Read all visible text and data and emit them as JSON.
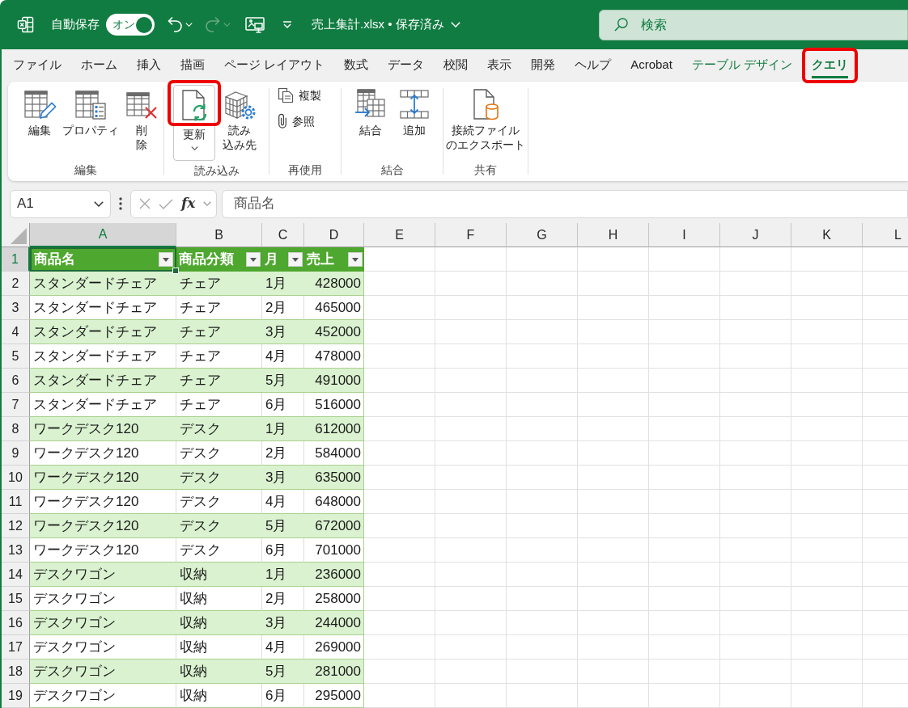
{
  "title_bar": {
    "autosave": {
      "label": "自動保存",
      "toggle_label": "オン",
      "on": true
    },
    "undo": {
      "disabled": false
    },
    "redo": {
      "disabled": true
    },
    "document_title": "売上集計.xlsx • 保存済み",
    "search": {
      "placeholder": "検索"
    }
  },
  "ribbon_tabs": [
    {
      "label": "ファイル",
      "kind": "standard",
      "selected": false,
      "highlighted": false
    },
    {
      "label": "ホーム",
      "kind": "standard",
      "selected": false,
      "highlighted": false
    },
    {
      "label": "挿入",
      "kind": "standard",
      "selected": false,
      "highlighted": false
    },
    {
      "label": "描画",
      "kind": "standard",
      "selected": false,
      "highlighted": false
    },
    {
      "label": "ページ レイアウト",
      "kind": "standard",
      "selected": false,
      "highlighted": false
    },
    {
      "label": "数式",
      "kind": "standard",
      "selected": false,
      "highlighted": false
    },
    {
      "label": "データ",
      "kind": "standard",
      "selected": false,
      "highlighted": false
    },
    {
      "label": "校閲",
      "kind": "standard",
      "selected": false,
      "highlighted": false
    },
    {
      "label": "表示",
      "kind": "standard",
      "selected": false,
      "highlighted": false
    },
    {
      "label": "開発",
      "kind": "standard",
      "selected": false,
      "highlighted": false
    },
    {
      "label": "ヘルプ",
      "kind": "standard",
      "selected": false,
      "highlighted": false
    },
    {
      "label": "Acrobat",
      "kind": "standard",
      "selected": false,
      "highlighted": false
    },
    {
      "label": "テーブル デザイン",
      "kind": "contextual",
      "selected": false,
      "highlighted": false
    },
    {
      "label": "クエリ",
      "kind": "contextual",
      "selected": true,
      "highlighted": true
    }
  ],
  "ribbon_groups": [
    {
      "label": "編集",
      "commands": [
        {
          "label": "編集",
          "kind": "large",
          "highlighted": false
        },
        {
          "label": "プロパティ",
          "kind": "large",
          "highlighted": false
        },
        {
          "label": "削除",
          "kind": "large",
          "highlighted": false
        }
      ]
    },
    {
      "label": "読み込み",
      "commands": [
        {
          "label": "更新",
          "kind": "split",
          "highlighted": true
        },
        {
          "label": "読み込み先",
          "kind": "large",
          "highlighted": false
        }
      ]
    },
    {
      "label": "再使用",
      "commands": [
        {
          "label": "複製",
          "kind": "small",
          "highlighted": false
        },
        {
          "label": "参照",
          "kind": "small",
          "highlighted": false
        }
      ]
    },
    {
      "label": "結合",
      "commands": [
        {
          "label": "結合",
          "kind": "large",
          "highlighted": false
        },
        {
          "label": "追加",
          "kind": "large",
          "highlighted": false
        }
      ]
    },
    {
      "label": "共有",
      "commands": [
        {
          "label": "接続ファイルのエクスポート",
          "kind": "large",
          "highlighted": false
        }
      ]
    }
  ],
  "formula_bar": {
    "name_box": "A1",
    "edit_buttons_disabled": true,
    "function_label": "fx",
    "formula": "商品名"
  },
  "sheet": {
    "columns": [
      {
        "label": "A",
        "selected": true
      },
      {
        "label": "B",
        "selected": false
      },
      {
        "label": "C",
        "selected": false
      },
      {
        "label": "D",
        "selected": false
      },
      {
        "label": "E",
        "selected": false
      },
      {
        "label": "F",
        "selected": false
      },
      {
        "label": "G",
        "selected": false
      },
      {
        "label": "H",
        "selected": false
      },
      {
        "label": "I",
        "selected": false
      },
      {
        "label": "J",
        "selected": false
      },
      {
        "label": "K",
        "selected": false
      },
      {
        "label": "L",
        "selected": false
      }
    ],
    "row_numbers": [
      {
        "label": "1",
        "selected": true
      },
      {
        "label": "2",
        "selected": false
      },
      {
        "label": "3",
        "selected": false
      },
      {
        "label": "4",
        "selected": false
      },
      {
        "label": "5",
        "selected": false
      },
      {
        "label": "6",
        "selected": false
      },
      {
        "label": "7",
        "selected": false
      },
      {
        "label": "8",
        "selected": false
      },
      {
        "label": "9",
        "selected": false
      },
      {
        "label": "10",
        "selected": false
      },
      {
        "label": "11",
        "selected": false
      },
      {
        "label": "12",
        "selected": false
      },
      {
        "label": "13",
        "selected": false
      },
      {
        "label": "14",
        "selected": false
      },
      {
        "label": "15",
        "selected": false
      },
      {
        "label": "16",
        "selected": false
      },
      {
        "label": "17",
        "selected": false
      },
      {
        "label": "18",
        "selected": false
      },
      {
        "label": "19",
        "selected": false
      }
    ],
    "table": {
      "headers": [
        {
          "label": "商品名",
          "selected": true
        },
        {
          "label": "商品分類",
          "selected": false
        },
        {
          "label": "月",
          "selected": false
        },
        {
          "label": "売上",
          "selected": false
        }
      ],
      "rows": [
        [
          "スタンダードチェア",
          "チェア",
          "1月",
          "428000"
        ],
        [
          "スタンダードチェア",
          "チェア",
          "2月",
          "465000"
        ],
        [
          "スタンダードチェア",
          "チェア",
          "3月",
          "452000"
        ],
        [
          "スタンダードチェア",
          "チェア",
          "4月",
          "478000"
        ],
        [
          "スタンダードチェア",
          "チェア",
          "5月",
          "491000"
        ],
        [
          "スタンダードチェア",
          "チェア",
          "6月",
          "516000"
        ],
        [
          "ワークデスク120",
          "デスク",
          "1月",
          "612000"
        ],
        [
          "ワークデスク120",
          "デスク",
          "2月",
          "584000"
        ],
        [
          "ワークデスク120",
          "デスク",
          "3月",
          "635000"
        ],
        [
          "ワークデスク120",
          "デスク",
          "4月",
          "648000"
        ],
        [
          "ワークデスク120",
          "デスク",
          "5月",
          "672000"
        ],
        [
          "ワークデスク120",
          "デスク",
          "6月",
          "701000"
        ],
        [
          "デスクワゴン",
          "収納",
          "1月",
          "236000"
        ],
        [
          "デスクワゴン",
          "収納",
          "2月",
          "258000"
        ],
        [
          "デスクワゴン",
          "収納",
          "3月",
          "244000"
        ],
        [
          "デスクワゴン",
          "収納",
          "4月",
          "269000"
        ],
        [
          "デスクワゴン",
          "収納",
          "5月",
          "281000"
        ],
        [
          "デスクワゴン",
          "収納",
          "6月",
          "295000"
        ]
      ]
    }
  }
}
